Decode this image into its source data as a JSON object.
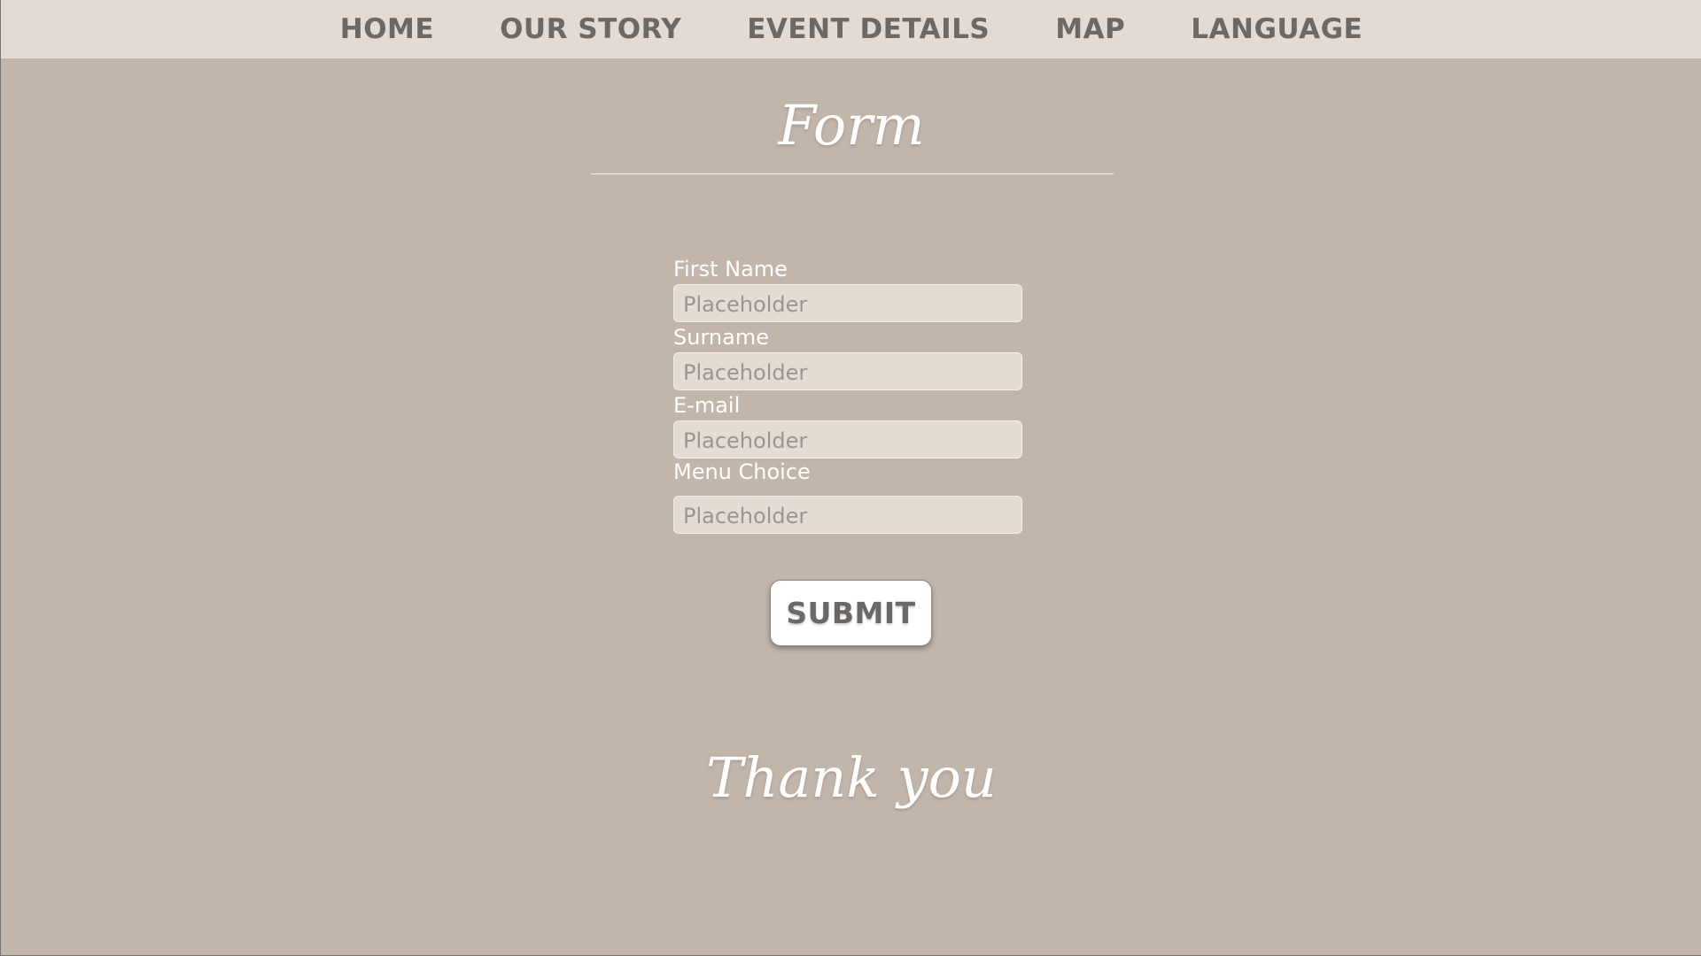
{
  "nav": {
    "items": [
      {
        "label": "HOME"
      },
      {
        "label": "OUR STORY"
      },
      {
        "label": "EVENT DETAILS"
      },
      {
        "label": "MAP"
      },
      {
        "label": "LANGUAGE"
      }
    ]
  },
  "form": {
    "title": "Form",
    "fields": [
      {
        "label": "First Name",
        "placeholder": "Placeholder",
        "value": ""
      },
      {
        "label": "Surname",
        "placeholder": "Placeholder",
        "value": ""
      },
      {
        "label": "E-mail",
        "placeholder": "Placeholder",
        "value": ""
      },
      {
        "label": "Menu Choice",
        "placeholder": "Placeholder",
        "value": ""
      }
    ],
    "submit_label": "SUBMIT"
  },
  "footer": {
    "thank_you": "Thank you"
  },
  "colors": {
    "background": "#c2b5aa",
    "nav_background": "#e3dbd3",
    "nav_text": "#6b6866",
    "input_background": "#e4dcd3",
    "label_text": "#ffffff"
  }
}
